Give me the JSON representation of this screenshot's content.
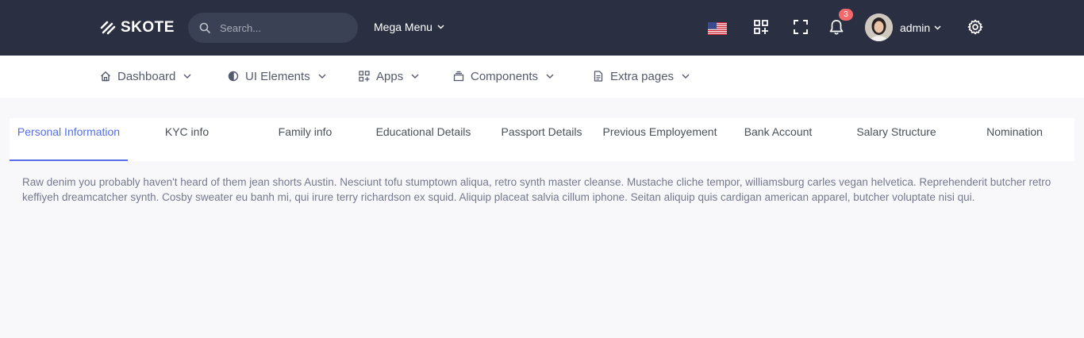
{
  "header": {
    "brand": "SKOTE",
    "search_placeholder": "Search...",
    "mega_menu": "Mega Menu",
    "notification_count": "3",
    "user_name": "admin"
  },
  "nav": {
    "items": [
      {
        "label": "Dashboard",
        "icon": "home-icon"
      },
      {
        "label": "UI Elements",
        "icon": "tune-icon"
      },
      {
        "label": "Apps",
        "icon": "apps-icon"
      },
      {
        "label": "Components",
        "icon": "collection-icon"
      },
      {
        "label": "Extra pages",
        "icon": "file-icon"
      }
    ]
  },
  "tabs": [
    {
      "label": "Personal Information",
      "active": true
    },
    {
      "label": "KYC info"
    },
    {
      "label": "Family info"
    },
    {
      "label": "Educational Details"
    },
    {
      "label": "Passport Details"
    },
    {
      "label": "Previous Employement"
    },
    {
      "label": "Bank Account"
    },
    {
      "label": "Salary Structure"
    },
    {
      "label": "Nomination"
    }
  ],
  "content": {
    "text": "Raw denim you probably haven't heard of them jean shorts Austin. Nesciunt tofu stumptown aliqua, retro synth master cleanse. Mustache cliche tempor, williamsburg carles vegan helvetica. Reprehenderit butcher retro keffiyeh dreamcatcher synth. Cosby sweater eu banh mi, qui irure terry richardson ex squid. Aliquip placeat salvia cillum iphone. Seitan aliquip quis cardigan american apparel, butcher voluptate nisi qui."
  },
  "colors": {
    "header_bg": "#2a3042",
    "accent": "#556ee6",
    "badge": "#f46a6a"
  }
}
